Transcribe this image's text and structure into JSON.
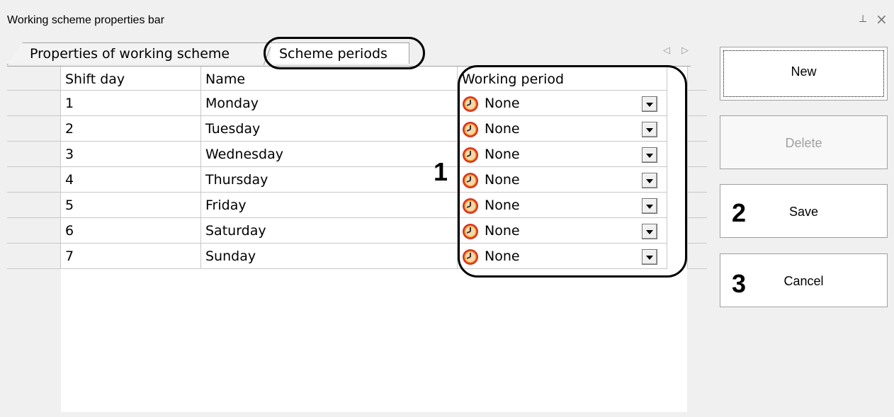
{
  "window": {
    "title": "Working scheme properties bar",
    "pin_glyph": "⊥",
    "close_glyph": "×"
  },
  "tabs": [
    {
      "label": "Properties of working scheme",
      "active": false
    },
    {
      "label": "Scheme periods",
      "active": true
    }
  ],
  "tab_scroll": {
    "left": "◁",
    "right": "▷"
  },
  "table": {
    "columns": [
      "Shift day",
      "Name",
      "Working period"
    ],
    "rows": [
      {
        "shift_day": "1",
        "name": "Monday",
        "period": "None"
      },
      {
        "shift_day": "2",
        "name": "Tuesday",
        "period": "None"
      },
      {
        "shift_day": "3",
        "name": "Wednesday",
        "period": "None"
      },
      {
        "shift_day": "4",
        "name": "Thursday",
        "period": "None"
      },
      {
        "shift_day": "5",
        "name": "Friday",
        "period": "None"
      },
      {
        "shift_day": "6",
        "name": "Saturday",
        "period": "None"
      },
      {
        "shift_day": "7",
        "name": "Sunday",
        "period": "None"
      }
    ],
    "period_icon": "clock-icon"
  },
  "buttons": {
    "new": "New",
    "delete": "Delete",
    "save": "Save",
    "cancel": "Cancel"
  },
  "annotations": {
    "period_column": "1",
    "save": "2",
    "cancel": "3"
  },
  "colors": {
    "clock_red": "#d9301e",
    "clock_orange": "#f08a1c",
    "disabled_text": "#a0a0a0"
  }
}
